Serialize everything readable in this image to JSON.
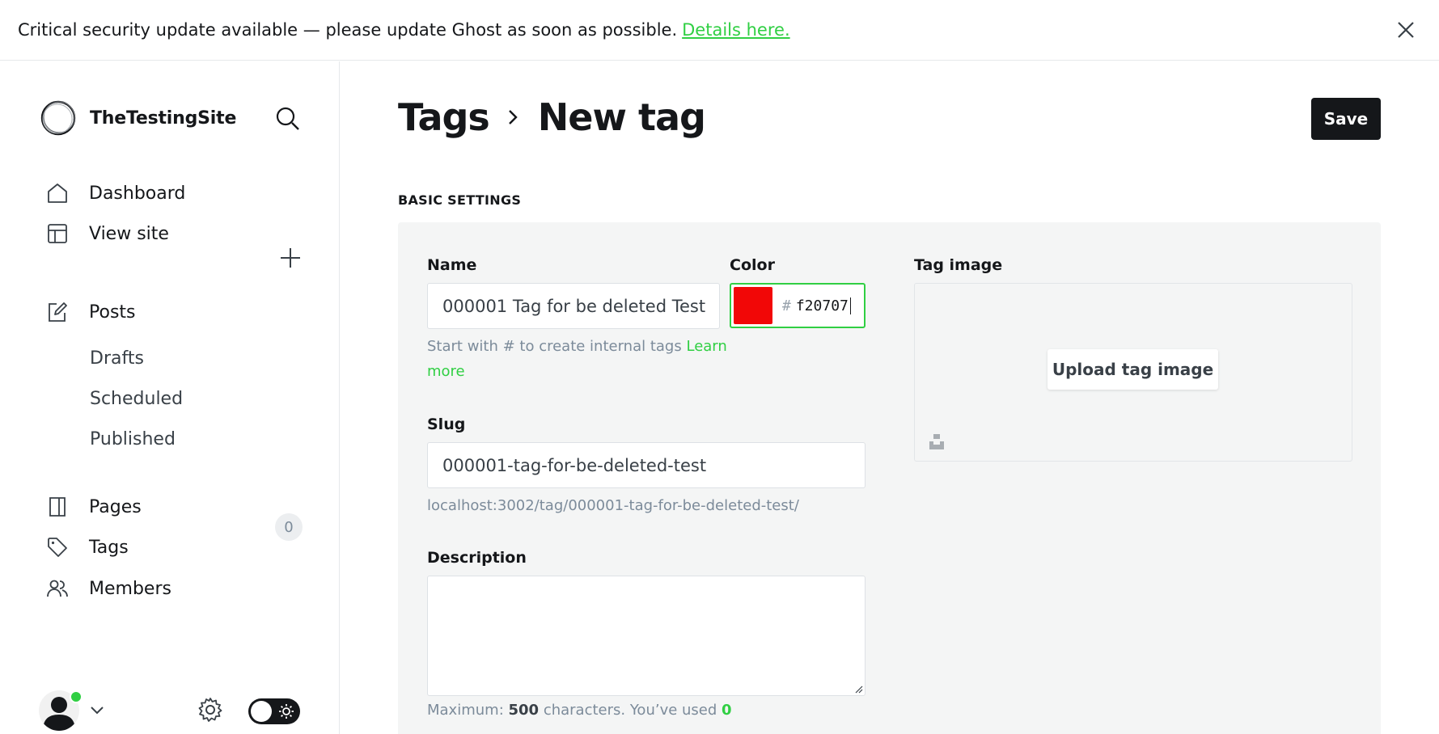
{
  "banner": {
    "message": "Critical security update available — please update Ghost as soon as possible.",
    "link_label": "Details here."
  },
  "sidebar": {
    "site_name": "TheTestingSite",
    "nav": {
      "dashboard": "Dashboard",
      "view_site": "View site",
      "posts": "Posts",
      "drafts": "Drafts",
      "scheduled": "Scheduled",
      "published": "Published",
      "pages": "Pages",
      "tags": "Tags",
      "members": "Members",
      "members_count": "0"
    }
  },
  "header": {
    "breadcrumb_parent": "Tags",
    "title": "New tag",
    "save_label": "Save"
  },
  "form": {
    "section_label": "BASIC SETTINGS",
    "name_label": "Name",
    "name_value": "000001 Tag for be deleted Test",
    "name_hint": "Start with # to create internal tags",
    "name_hint_link": "Learn more",
    "color_label": "Color",
    "color_hash": "#",
    "color_value": "f20707",
    "color_swatch": "#f20707",
    "slug_label": "Slug",
    "slug_value": "000001-tag-for-be-deleted-test",
    "slug_url": "localhost:3002/tag/000001-tag-for-be-deleted-test/",
    "description_label": "Description",
    "description_value": "",
    "counter_prefix": "Maximum:",
    "counter_max": "500",
    "counter_mid": "characters. You’ve used",
    "counter_used": "0",
    "tag_image_label": "Tag image",
    "upload_label": "Upload tag image"
  },
  "colors": {
    "accent": "#30cf43",
    "primary": "#15171a"
  }
}
